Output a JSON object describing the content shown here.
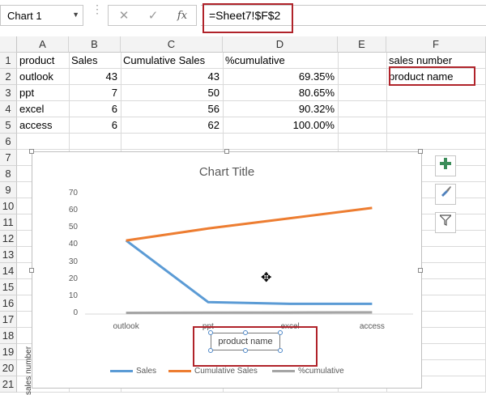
{
  "name_box": {
    "value": "Chart 1"
  },
  "formula_bar": {
    "cancel_icon": "close-icon",
    "enter_icon": "check-icon",
    "fx_label": "fx",
    "formula": "=Sheet7!$F$2"
  },
  "columns": [
    "A",
    "B",
    "C",
    "D",
    "E",
    "F"
  ],
  "rows": [
    "1",
    "2",
    "3",
    "4",
    "5",
    "6",
    "7",
    "8",
    "9",
    "10",
    "11",
    "12",
    "13",
    "14",
    "15",
    "16",
    "17",
    "18",
    "19",
    "20",
    "21"
  ],
  "table": {
    "headers": [
      "product",
      "Sales",
      "Cumulative Sales",
      "%cumulative"
    ],
    "rows": [
      [
        "outlook",
        "43",
        "43",
        "69.35%"
      ],
      [
        "ppt",
        "7",
        "50",
        "80.65%"
      ],
      [
        "excel",
        "6",
        "56",
        "90.32%"
      ],
      [
        "access",
        "6",
        "62",
        "100.00%"
      ]
    ]
  },
  "f1": "sales number",
  "f2": "product name",
  "colors": {
    "accent_red": "#b0232a",
    "sales": "#5b9bd5",
    "cumulative": "#ed7d31",
    "pct": "#a5a5a5"
  },
  "chart_data": {
    "type": "line",
    "title": "Chart Title",
    "ylabel": "sales number",
    "xlabel": "product name",
    "categories": [
      "outlook",
      "ppt",
      "excel",
      "access"
    ],
    "yticks": [
      "0",
      "10",
      "20",
      "30",
      "40",
      "50",
      "60",
      "70"
    ],
    "ylim": [
      0,
      70
    ],
    "series": [
      {
        "name": "Sales",
        "values": [
          43,
          7,
          6,
          6
        ]
      },
      {
        "name": "Cumulative Sales",
        "values": [
          43,
          50,
          56,
          62
        ]
      },
      {
        "name": "%cumulative",
        "values": [
          0.6935,
          0.8065,
          0.9032,
          1.0
        ]
      }
    ],
    "legend": "bottom"
  },
  "tools": {
    "add": "plus-icon",
    "style": "brush-icon",
    "filter": "filter-icon"
  }
}
